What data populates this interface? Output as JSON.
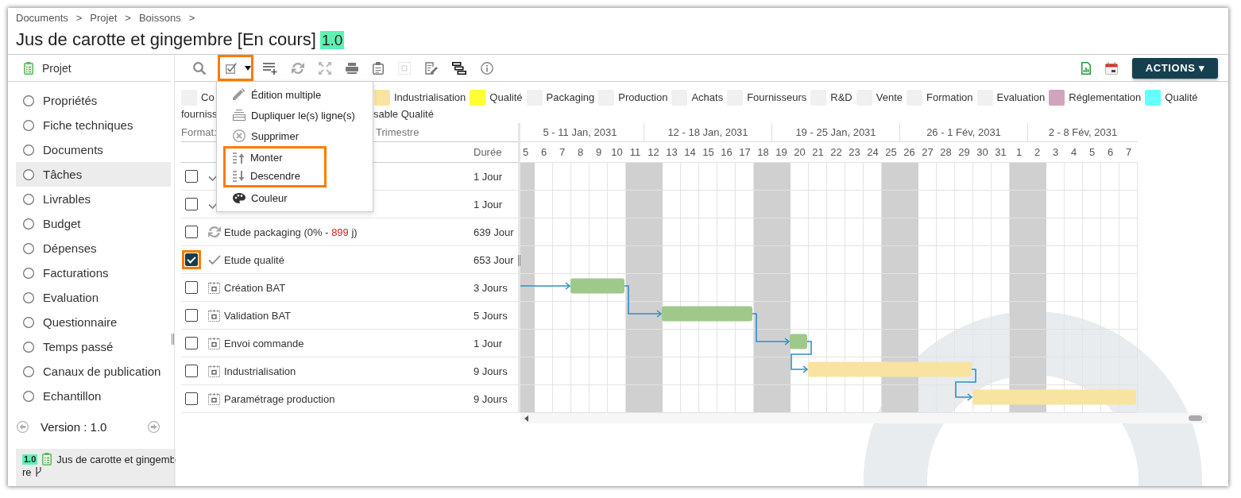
{
  "breadcrumb": [
    {
      "label": "Documents",
      "separator": ">"
    },
    {
      "label": "Projet",
      "separator": ">"
    },
    {
      "label": "Boissons",
      "separator": ">"
    }
  ],
  "title": {
    "text": "Jus de carotte et gingembre [En cours]",
    "version": "1.0"
  },
  "sidebar": {
    "header": "Projet",
    "items": [
      {
        "label": "Propriétés",
        "selected": false
      },
      {
        "label": "Fiche techniques",
        "selected": false
      },
      {
        "label": "Documents",
        "selected": false
      },
      {
        "label": "Tâches",
        "selected": true
      },
      {
        "label": "Livrables",
        "selected": false
      },
      {
        "label": "Budget",
        "selected": false
      },
      {
        "label": "Dépenses",
        "selected": false
      },
      {
        "label": "Facturations",
        "selected": false
      },
      {
        "label": "Evaluation",
        "selected": false
      },
      {
        "label": "Questionnaire",
        "selected": false
      },
      {
        "label": "Temps passé",
        "selected": false
      },
      {
        "label": "Canaux de publication",
        "selected": false
      },
      {
        "label": "Echantillon",
        "selected": false
      }
    ],
    "version": "Version : 1.0",
    "document": {
      "version": "1.0",
      "name": "Jus de carotte et gingembre"
    }
  },
  "toolbar": {
    "tools": [
      {
        "kind": "search",
        "disabled": false,
        "highlighted": false,
        "has_menu": false
      },
      {
        "kind": "select",
        "disabled": false,
        "highlighted": true,
        "has_menu": true
      },
      {
        "kind": "add_row",
        "disabled": false,
        "highlighted": false,
        "has_menu": false
      },
      {
        "kind": "refresh",
        "disabled": false,
        "highlighted": false,
        "has_menu": false
      },
      {
        "kind": "fullscreen",
        "disabled": false,
        "highlighted": false,
        "has_menu": false
      },
      {
        "kind": "print",
        "disabled": false,
        "highlighted": false,
        "has_menu": false
      },
      {
        "kind": "clipboard",
        "disabled": false,
        "highlighted": false,
        "has_menu": false
      },
      {
        "kind": "grid",
        "disabled": true,
        "highlighted": false,
        "has_menu": false
      },
      {
        "kind": "edit",
        "disabled": false,
        "highlighted": false,
        "has_menu": false
      },
      {
        "kind": "gantt",
        "disabled": false,
        "highlighted": false,
        "has_menu": false
      },
      {
        "kind": "info",
        "disabled": false,
        "highlighted": false,
        "has_menu": false
      }
    ],
    "right_tools": [
      {
        "kind": "spreadsheet"
      },
      {
        "kind": "calendar"
      }
    ],
    "actions": "ACTIONS ▾"
  },
  "menu": {
    "items": [
      {
        "kind": "edit",
        "label": "Édition multiple",
        "highlighted": false
      },
      {
        "kind": "duplicate",
        "label": "Dupliquer le(s) ligne(s)",
        "highlighted": false
      },
      {
        "kind": "delete",
        "label": "Supprimer",
        "highlighted": false
      },
      {
        "kind": "move_up",
        "label": "Monter",
        "highlighted": true
      },
      {
        "kind": "move_down",
        "label": "Descendre",
        "highlighted": true
      },
      {
        "kind": "color",
        "label": "Couleur",
        "highlighted": false
      }
    ]
  },
  "legend": {
    "items": [
      {
        "label": "Co",
        "color": "#f0f0f0"
      },
      {
        "label": "Industrialisation",
        "color": "#fae3a0"
      },
      {
        "label": "Qualité",
        "color": "#ffff33"
      },
      {
        "label": "Packaging",
        "color": "#f0f0f0"
      },
      {
        "label": "Production",
        "color": "#f0f0f0"
      },
      {
        "label": "Achats",
        "color": "#f0f0f0"
      },
      {
        "label": "Fournisseurs",
        "color": "#f0f0f0"
      },
      {
        "label": "R&D",
        "color": "#f0f0f0"
      },
      {
        "label": "Vente",
        "color": "#f0f0f0"
      },
      {
        "label": "Formation",
        "color": "#f0f0f0"
      },
      {
        "label": "Evaluation",
        "color": "#f0f0f0"
      },
      {
        "label": "Réglementation",
        "color": "#cfa5bb"
      },
      {
        "label": "Qualité",
        "color": "#66ffff"
      }
    ],
    "second_line": [
      "fourniss",
      "sable Qualité"
    ]
  },
  "table": {
    "scale_label": "Format:",
    "scale_value": "Trimestre",
    "duration_header": "Durée",
    "rows": [
      {
        "checked": false,
        "highlighted": false,
        "kind": "done",
        "duration": "1 Jour"
      },
      {
        "checked": false,
        "highlighted": false,
        "kind": "done",
        "duration": "1 Jour"
      },
      {
        "checked": false,
        "highlighted": false,
        "kind": "in_progress",
        "name": "Etude packaging (0% - ",
        "overdue": "899",
        "name_end": " j)",
        "duration": "639 Jour"
      },
      {
        "checked": true,
        "highlighted": true,
        "kind": "done",
        "name": "Etude qualité",
        "duration": "653 Jour"
      },
      {
        "checked": false,
        "highlighted": false,
        "kind": "planned",
        "name": "Création BAT",
        "duration": "3 Jours",
        "bar": {
          "color": "#9fc98a",
          "linked": true
        }
      },
      {
        "checked": false,
        "highlighted": false,
        "kind": "planned",
        "name": "Validation BAT",
        "duration": "5 Jours",
        "bar": {
          "color": "#9fc98a",
          "linked": true
        }
      },
      {
        "checked": false,
        "highlighted": false,
        "kind": "planned",
        "name": "Envoi commande",
        "duration": "1 Jour",
        "bar": {
          "color": "#9fc98a",
          "linked": true
        }
      },
      {
        "checked": false,
        "highlighted": false,
        "kind": "planned",
        "name": "Industrialisation",
        "duration": "9 Jours",
        "bar": {
          "color": "#f8e3a1",
          "linked": true
        }
      },
      {
        "checked": false,
        "highlighted": false,
        "kind": "planned",
        "name": "Paramétrage production",
        "duration": "9 Jours",
        "bar": {
          "color": "#f8e3a1",
          "linked": true
        }
      }
    ]
  },
  "gantt": {
    "weeks": [
      "5 - 11 Jan, 2031",
      "12 - 18 Jan, 2031",
      "19 - 25 Jan, 2031",
      "26 - 1 Fév, 2031",
      "2 - 8 Fév, 2031"
    ],
    "days": [
      {
        "label": "5",
        "weekend": true
      },
      {
        "label": "6",
        "weekend": false
      },
      {
        "label": "7",
        "weekend": false
      },
      {
        "label": "8",
        "weekend": false
      },
      {
        "label": "9",
        "weekend": false
      },
      {
        "label": "10",
        "weekend": false
      },
      {
        "label": "11",
        "weekend": true
      },
      {
        "label": "12",
        "weekend": true
      },
      {
        "label": "13",
        "weekend": false
      },
      {
        "label": "14",
        "weekend": false
      },
      {
        "label": "15",
        "weekend": false
      },
      {
        "label": "16",
        "weekend": false
      },
      {
        "label": "17",
        "weekend": false
      },
      {
        "label": "18",
        "weekend": true
      },
      {
        "label": "19",
        "weekend": true
      },
      {
        "label": "20",
        "weekend": false
      },
      {
        "label": "21",
        "weekend": false
      },
      {
        "label": "22",
        "weekend": false
      },
      {
        "label": "23",
        "weekend": false
      },
      {
        "label": "24",
        "weekend": false
      },
      {
        "label": "25",
        "weekend": true
      },
      {
        "label": "26",
        "weekend": true
      },
      {
        "label": "27",
        "weekend": false
      },
      {
        "label": "28",
        "weekend": false
      },
      {
        "label": "29",
        "weekend": false
      },
      {
        "label": "30",
        "weekend": false
      },
      {
        "label": "31",
        "weekend": false
      },
      {
        "label": "1",
        "weekend": true
      },
      {
        "label": "2",
        "weekend": true
      },
      {
        "label": "3",
        "weekend": false
      },
      {
        "label": "4",
        "weekend": false
      },
      {
        "label": "5",
        "weekend": false
      },
      {
        "label": "6",
        "weekend": false
      },
      {
        "label": "7",
        "weekend": false
      }
    ]
  }
}
